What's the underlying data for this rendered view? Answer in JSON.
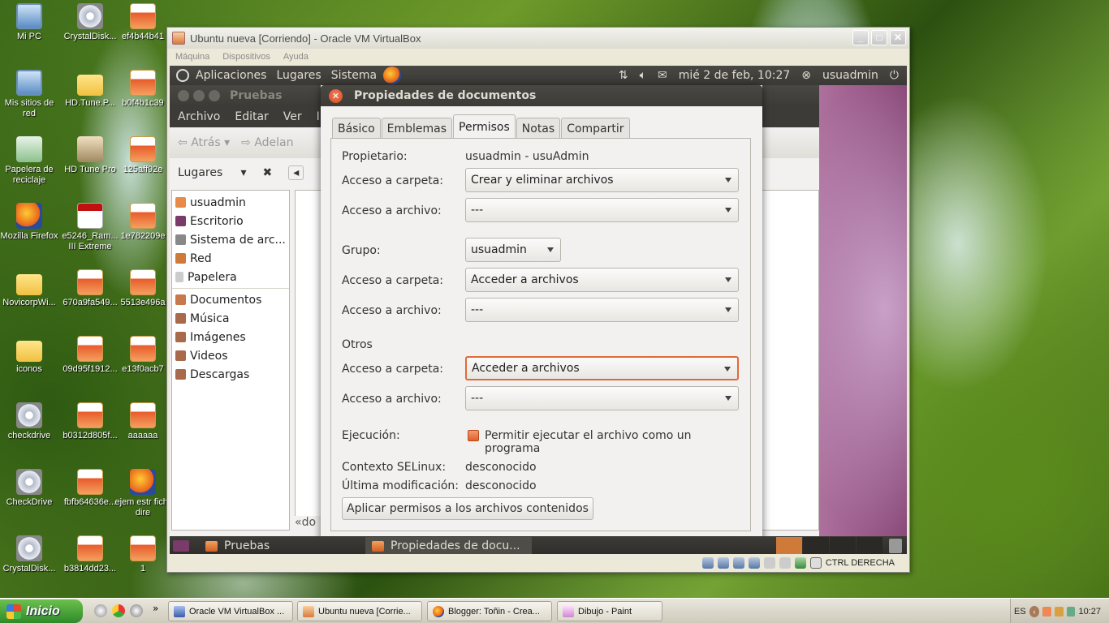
{
  "desktop": {
    "icons": [
      {
        "label": "Mi PC",
        "icon": "computer-icon"
      },
      {
        "label": "CrystalDisk...",
        "icon": "disk-icon"
      },
      {
        "label": "ef4b44b41",
        "icon": "package-icon"
      },
      {
        "label": "Mis sitios de red",
        "icon": "network-icon"
      },
      {
        "label": "HD.Tune.P...",
        "icon": "folder-icon"
      },
      {
        "label": "b0f4b1c39",
        "icon": "package-icon"
      },
      {
        "label": "Papelera de reciclaje",
        "icon": "recycle-bin-icon"
      },
      {
        "label": "HD Tune Pro",
        "icon": "hdtune-icon"
      },
      {
        "label": "125aff92e",
        "icon": "package-icon"
      },
      {
        "label": "Mozilla Firefox",
        "icon": "firefox-icon"
      },
      {
        "label": "e5246_Ram... III Extreme",
        "icon": "pdf-icon"
      },
      {
        "label": "1e782209e",
        "icon": "package-icon"
      },
      {
        "label": "NovicorpWi...",
        "icon": "folder-icon"
      },
      {
        "label": "670a9fa549...",
        "icon": "package-icon"
      },
      {
        "label": "5513e496a",
        "icon": "package-icon"
      },
      {
        "label": "iconos",
        "icon": "folder-icon"
      },
      {
        "label": "09d95f1912...",
        "icon": "package-icon"
      },
      {
        "label": "e13f0acb7",
        "icon": "package-icon"
      },
      {
        "label": "checkdrive",
        "icon": "checkdrive-icon"
      },
      {
        "label": "b0312d805f...",
        "icon": "package-icon"
      },
      {
        "label": "aaaaaa",
        "icon": "package-icon"
      },
      {
        "label": "CheckDrive",
        "icon": "checkdrive-icon"
      },
      {
        "label": "fbfb64636e...",
        "icon": "package-icon"
      },
      {
        "label": "ejem estr fich-dire",
        "icon": "chrome-doc-icon"
      },
      {
        "label": "CrystalDisk...",
        "icon": "disk-icon"
      },
      {
        "label": "b3814dd23...",
        "icon": "package-icon"
      },
      {
        "label": "1",
        "icon": "package-icon"
      }
    ]
  },
  "vbox": {
    "title": "Ubuntu nueva [Corriendo] - Oracle VM VirtualBox",
    "menu": [
      "Máquina",
      "Dispositivos",
      "Ayuda"
    ],
    "host_key": "CTRL DERECHA"
  },
  "ubuntu": {
    "top_menus": [
      "Aplicaciones",
      "Lugares",
      "Sistema"
    ],
    "clock": "mié 2 de feb, 10:27",
    "user": "usuadmin",
    "nautilus": {
      "title": "Pruebas",
      "menus": [
        "Archivo",
        "Editar",
        "Ver",
        "Ir"
      ],
      "back": "Atrás",
      "forward": "Adelan",
      "places_label": "Lugares",
      "places": [
        "usuadmin",
        "Escritorio",
        "Sistema de arc...",
        "Red",
        "Papelera"
      ],
      "bookmarks": [
        "Documentos",
        "Música",
        "Imágenes",
        "Videos",
        "Descargas"
      ],
      "breadcrumb": "«do"
    },
    "dialog": {
      "title": "Propiedades de documentos",
      "tabs": [
        "Básico",
        "Emblemas",
        "Permisos",
        "Notas",
        "Compartir"
      ],
      "active_tab": "Permisos",
      "owner_label": "Propietario:",
      "owner_value": "usuadmin - usuAdmin",
      "folder_access_label": "Acceso a carpeta:",
      "file_access_label": "Acceso a archivo:",
      "owner_folder_access": "Crear y eliminar archivos",
      "owner_file_access": "---",
      "group_label": "Grupo:",
      "group_value": "usuadmin",
      "group_folder_access": "Acceder a archivos",
      "group_file_access": "---",
      "others_label": "Otros",
      "others_folder_access": "Acceder a archivos",
      "others_file_access": "---",
      "exec_label": "Ejecución:",
      "exec_checkbox": "Permitir ejecutar el archivo como un programa",
      "selinux_label": "Contexto SELinux:",
      "selinux_value": "desconocido",
      "modified_label": "Última modificación:",
      "modified_value": "desconocido",
      "apply_button": "Aplicar permisos a los archivos contenidos"
    },
    "bottom_tasks": [
      "Pruebas",
      "Propiedades de docu..."
    ]
  },
  "taskbar": {
    "start": "Inicio",
    "tasks": [
      "Oracle VM VirtualBox ...",
      "Ubuntu nueva [Corrie...",
      "Blogger: Toñin - Crea...",
      "Dibujo - Paint"
    ],
    "lang": "ES",
    "clock": "10:27"
  },
  "colors": {
    "ubuntu_orange": "#e0602c",
    "panel_dark": "#3c3b37"
  }
}
